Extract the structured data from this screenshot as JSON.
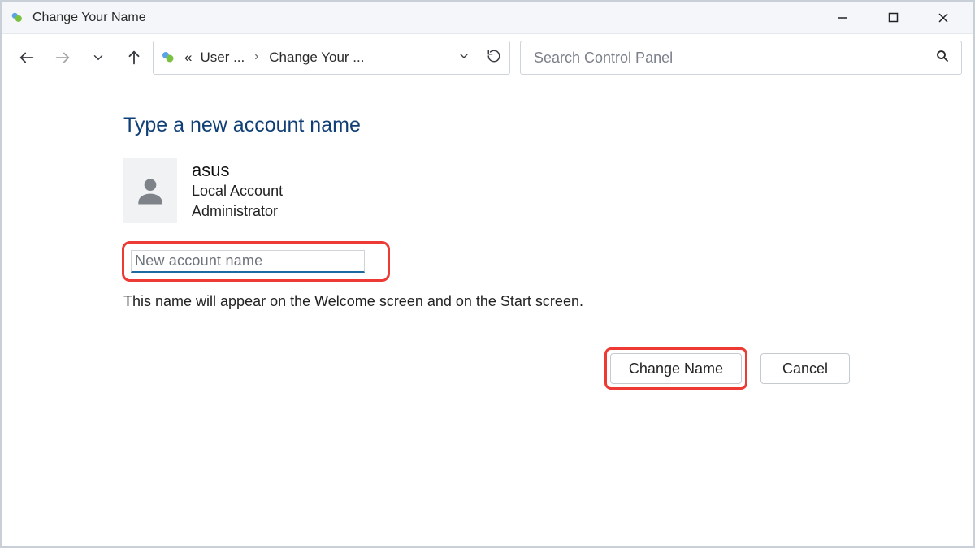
{
  "window": {
    "title": "Change Your Name"
  },
  "address": {
    "crumb_prefix": "«",
    "crumb1": "User ...",
    "crumb2": "Change Your ..."
  },
  "search": {
    "placeholder": "Search Control Panel"
  },
  "main": {
    "heading": "Type a new account name",
    "account_name": "asus",
    "account_type": "Local Account",
    "account_role": "Administrator",
    "input_placeholder": "New account name",
    "hint": "This name will appear on the Welcome screen and on the Start screen."
  },
  "buttons": {
    "change": "Change Name",
    "cancel": "Cancel"
  }
}
